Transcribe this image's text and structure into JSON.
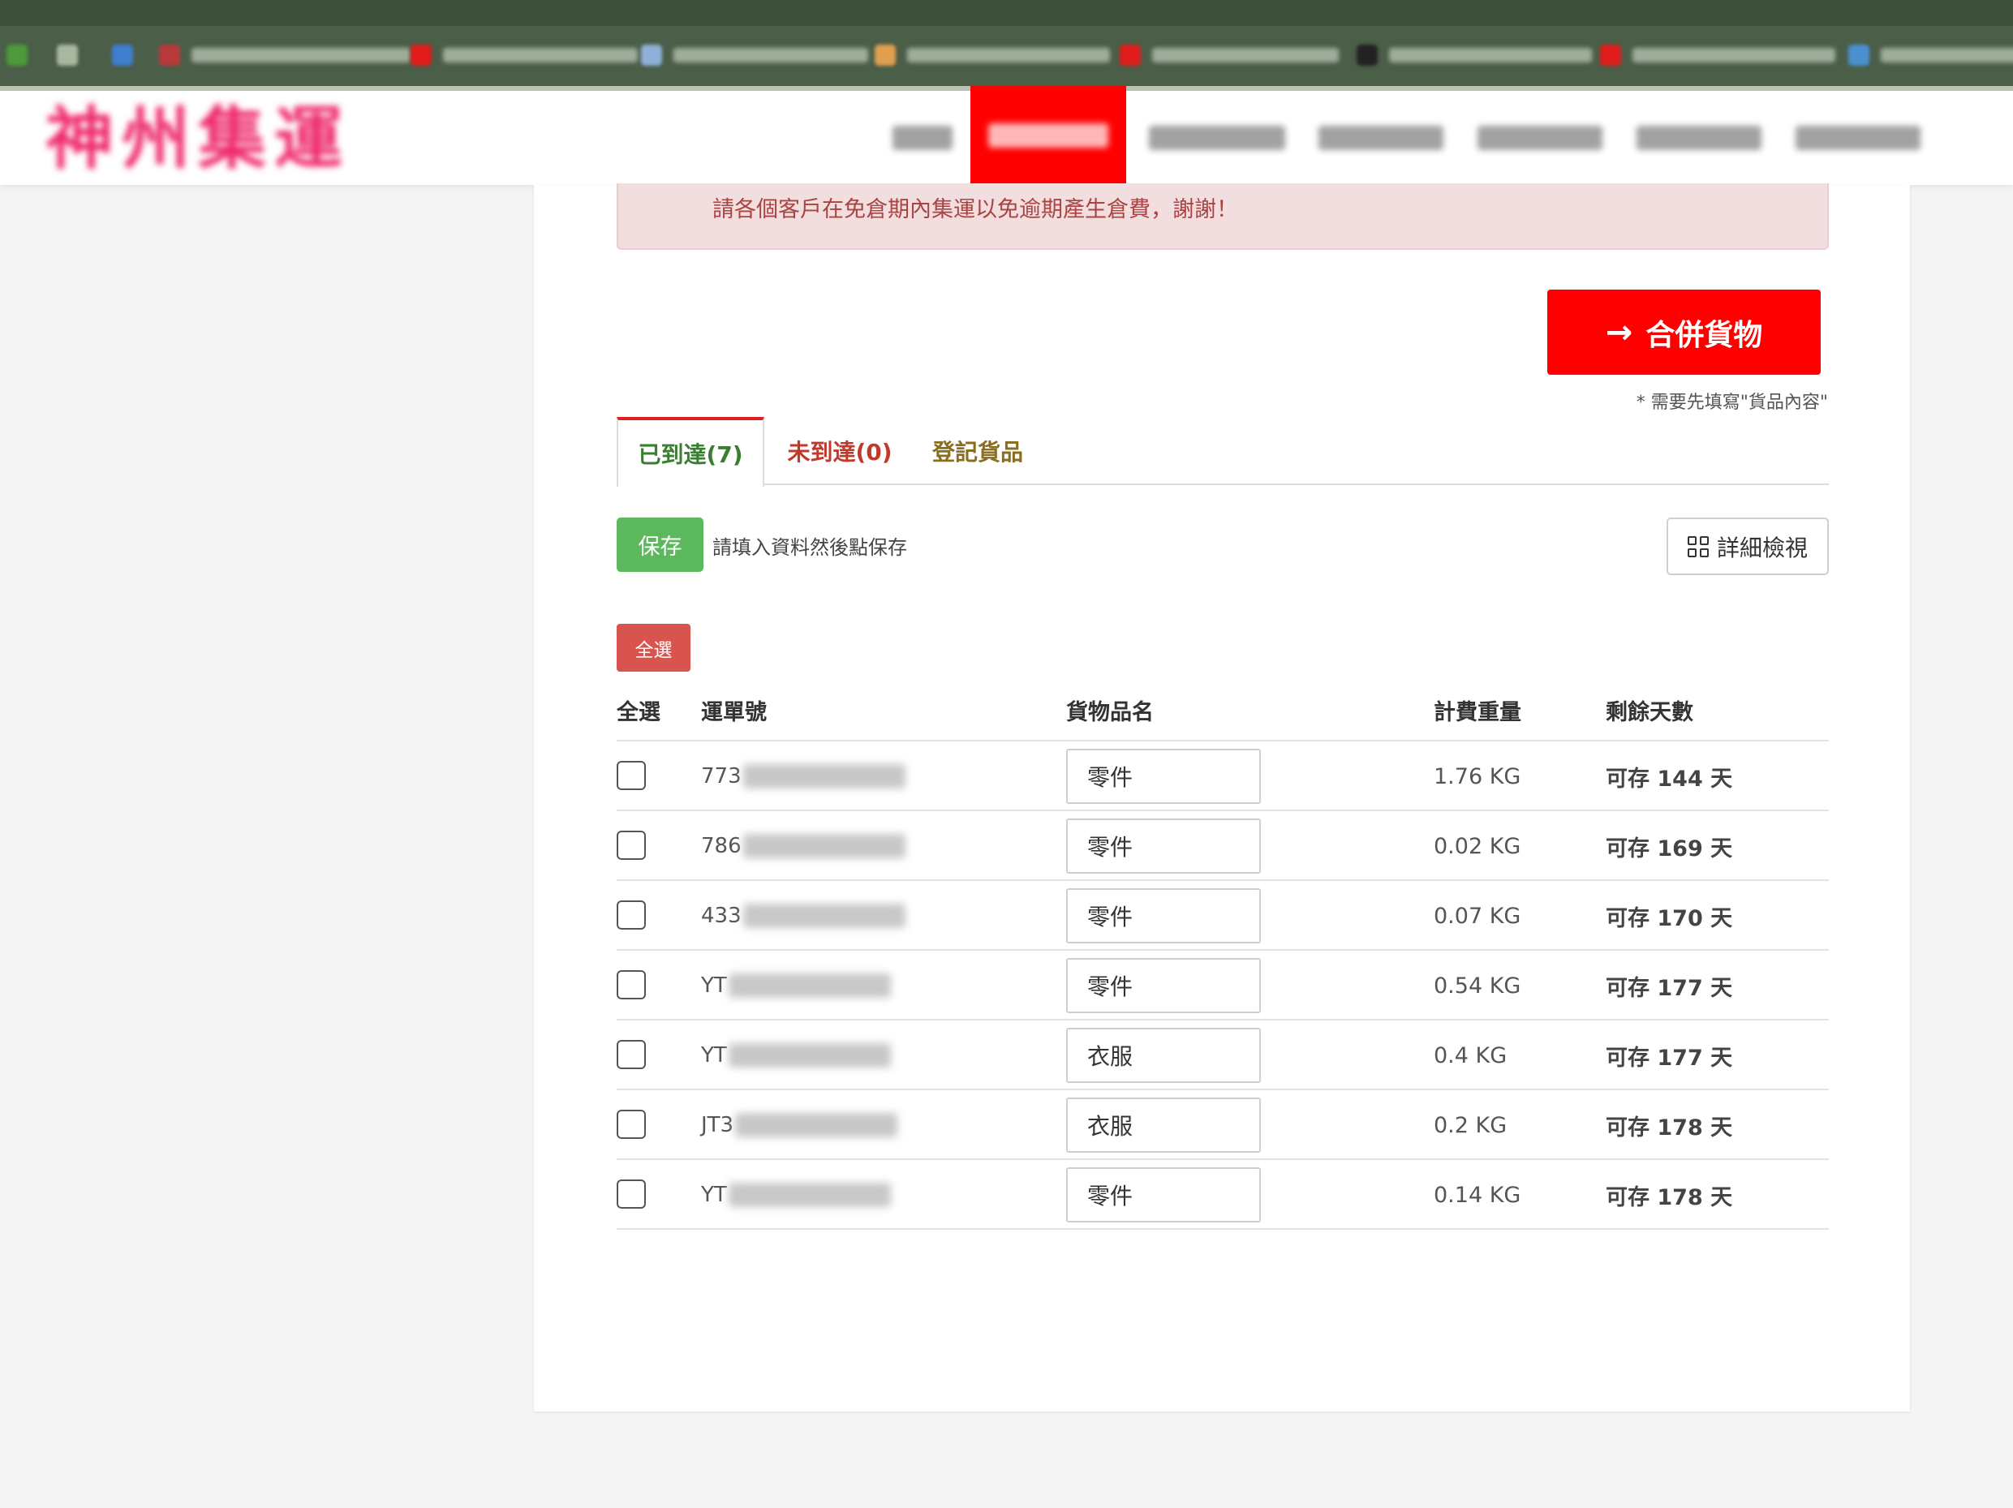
{
  "browser": {
    "bookmarks": [
      {
        "icon": "leaf-icon",
        "color": "#4c9a3a"
      },
      {
        "icon": "page-icon",
        "color": "#a8b8a0"
      },
      {
        "icon": "blue-app-icon",
        "color": "#3f7fd0"
      },
      {
        "icon": "red-star-icon",
        "color": "#b83a3a"
      },
      {
        "icon": "youtube-icon",
        "color": "#e21b1b"
      },
      {
        "icon": "doc-icon",
        "color": "#8fb0d8"
      },
      {
        "icon": "photos-icon",
        "color": "#e0a050"
      },
      {
        "icon": "youtube-icon",
        "color": "#e21b1b"
      },
      {
        "icon": "black-circle-icon",
        "color": "#222222"
      },
      {
        "icon": "youtube-icon",
        "color": "#e21b1b"
      },
      {
        "icon": "cloud-icon",
        "color": "#4a90d0"
      }
    ]
  },
  "header": {
    "logo_text": "神州集運",
    "active_nav": "nav-active"
  },
  "alert": {
    "text": "請各個客戶在免倉期內集運以免逾期產生倉費，謝謝！"
  },
  "merge": {
    "arrow": "→",
    "label": "合併貨物",
    "note": "* 需要先填寫\"貨品內容\""
  },
  "tabs": [
    {
      "label": "已到達(7)"
    },
    {
      "label": "未到達(0)"
    },
    {
      "label": "登記貨品"
    }
  ],
  "toolbar": {
    "save_label": "保存",
    "save_hint": "請填入資料然後點保存",
    "detail_label": "詳細檢視",
    "select_all_label": "全選"
  },
  "table": {
    "headers": [
      "全選",
      "運單號",
      "貨物品名",
      "計費重量",
      "剩餘天數"
    ],
    "rows": [
      {
        "waybill_prefix": "773",
        "goods": "零件",
        "weight": "1.76 KG",
        "days": "可存 144 天"
      },
      {
        "waybill_prefix": "786",
        "goods": "零件",
        "weight": "0.02 KG",
        "days": "可存 169 天"
      },
      {
        "waybill_prefix": "433",
        "goods": "零件",
        "weight": "0.07 KG",
        "days": "可存 170 天"
      },
      {
        "waybill_prefix": "YT",
        "goods": "零件",
        "weight": "0.54 KG",
        "days": "可存 177 天"
      },
      {
        "waybill_prefix": "YT",
        "goods": "衣服",
        "weight": "0.4 KG",
        "days": "可存 177 天"
      },
      {
        "waybill_prefix": "JT3",
        "goods": "衣服",
        "weight": "0.2 KG",
        "days": "可存 178 天"
      },
      {
        "waybill_prefix": "YT",
        "goods": "零件",
        "weight": "0.14 KG",
        "days": "可存 178 天"
      }
    ]
  }
}
